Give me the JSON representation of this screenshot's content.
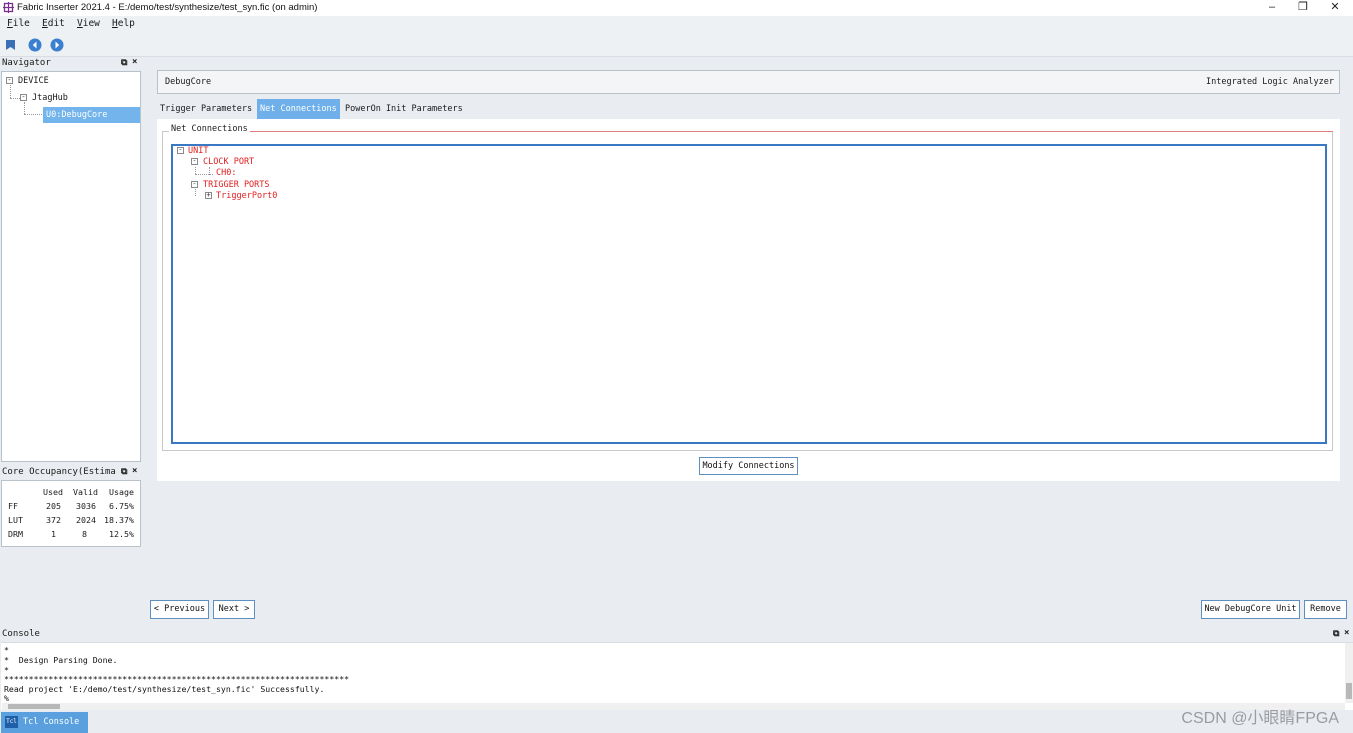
{
  "window": {
    "title": "Fabric Inserter 2021.4 - E:/demo/test/synthesize/test_syn.fic (on admin)",
    "minimize_glyph": "–",
    "restore_glyph": "❐",
    "close_glyph": "✕"
  },
  "menu": {
    "file": {
      "first": "F",
      "rest": "ile"
    },
    "edit": {
      "first": "E",
      "rest": "dit"
    },
    "view": {
      "first": "V",
      "rest": "iew"
    },
    "help": {
      "first": "H",
      "rest": "elp"
    }
  },
  "toolbar": {
    "icons": [
      "save-icon",
      "back-icon",
      "forward-icon"
    ]
  },
  "navigator": {
    "title": "Navigator",
    "float_glyph": "⧉",
    "close_glyph": "×",
    "tree": [
      {
        "label": "DEVICE"
      },
      {
        "label": "JtagHub"
      },
      {
        "label": "U0:DebugCore",
        "selected": true
      }
    ]
  },
  "occupancy": {
    "title": "Core Occupancy(Estima",
    "float_glyph": "⧉",
    "close_glyph": "×",
    "columns": [
      "",
      "Used",
      "Valid",
      "Usage"
    ],
    "rows": [
      [
        "FF",
        "205",
        "3036",
        "6.75%"
      ],
      [
        "LUT",
        "372",
        "2024",
        "18.37%"
      ],
      [
        "DRM",
        "1",
        "8",
        "12.5%"
      ]
    ]
  },
  "core": {
    "name": "DebugCore",
    "type": "Integrated Logic Analyzer"
  },
  "tabs": [
    {
      "label": "Trigger Parameters",
      "active": false
    },
    {
      "label": "Net Connections",
      "active": true
    },
    {
      "label": "PowerOn Init Parameters",
      "active": false
    }
  ],
  "net_connections": {
    "group_title": "Net Connections",
    "tree": {
      "unit": "UNIT",
      "clock_port": "CLOCK PORT",
      "ch0": "CH0:",
      "trigger_ports": "TRIGGER PORTS",
      "trigger_port0": "TriggerPort0"
    },
    "modify_button": "Modify Connections"
  },
  "nav_buttons": {
    "previous": "< Previous",
    "next": "Next >",
    "new_unit": "New DebugCore Unit",
    "remove": "Remove"
  },
  "console": {
    "title": "Console",
    "float_glyph": "⧉",
    "close_glyph": "×",
    "lines": [
      "*",
      "*  Design Parsing Done.",
      "*",
      "**********************************************************************",
      "Read project 'E:/demo/test/synthesize/test_syn.fic' Successfully.",
      "%"
    ],
    "tab_label": "Tcl Console",
    "tab_icon_text": "Tcl"
  },
  "watermark": "CSDN @小眼睛FPGA",
  "colors": {
    "accent": "#6fb0ea",
    "tree_text": "#e02020",
    "tree_border": "#3b78c4"
  }
}
